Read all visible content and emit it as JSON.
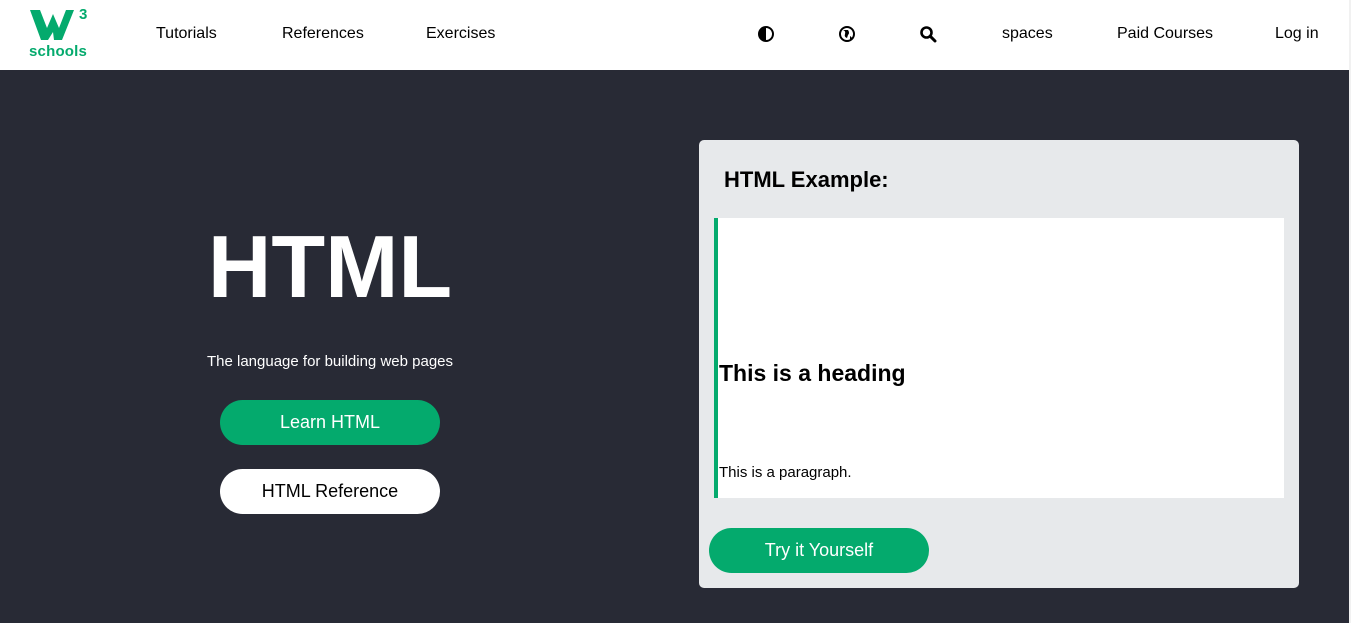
{
  "logo": {
    "superscript": "3",
    "wordmark": "schools",
    "color": "#04aa6d"
  },
  "nav": {
    "tutorials": "Tutorials",
    "references": "References",
    "exercises": "Exercises",
    "icons": [
      "contrast-icon",
      "globe-icon",
      "search-icon"
    ],
    "spaces": "spaces",
    "paid_courses": "Paid Courses",
    "login": "Log in"
  },
  "hero": {
    "title": "HTML",
    "subtitle": "The language for building web pages",
    "learn_button": "Learn HTML",
    "reference_button": "HTML Reference"
  },
  "example": {
    "title": "HTML Example:",
    "heading": "This is a heading",
    "paragraph": "This is a paragraph.",
    "try_button": "Try it Yourself"
  },
  "colors": {
    "accent": "#04aa6d",
    "background": "#282a35",
    "card": "#e7e9eb"
  }
}
